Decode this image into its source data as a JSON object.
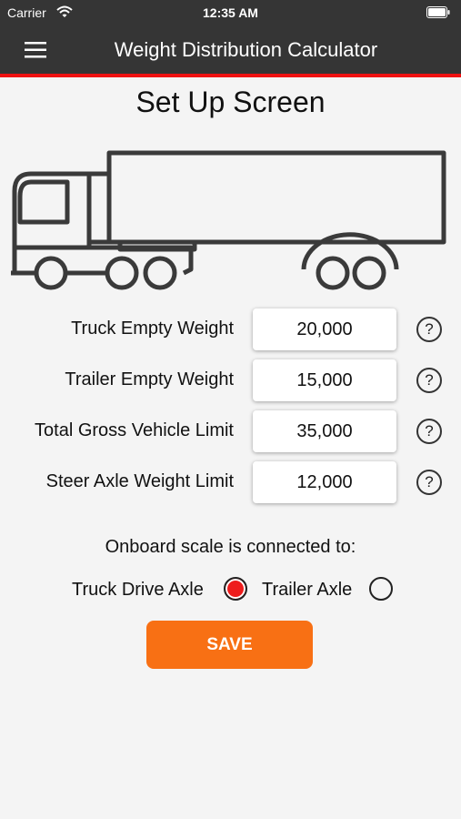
{
  "status_bar": {
    "carrier": "Carrier",
    "time": "12:35 AM"
  },
  "header": {
    "title": "Weight Distribution Calculator"
  },
  "page": {
    "title": "Set Up Screen"
  },
  "fields": [
    {
      "label": "Truck Empty Weight",
      "value": "20,000"
    },
    {
      "label": "Trailer Empty Weight",
      "value": "15,000"
    },
    {
      "label": "Total Gross Vehicle Limit",
      "value": "35,000"
    },
    {
      "label": "Steer Axle Weight Limit",
      "value": "12,000"
    }
  ],
  "help_symbol": "?",
  "scale": {
    "prompt": "Onboard scale is connected to:",
    "options": [
      {
        "label": "Truck Drive Axle",
        "selected": true
      },
      {
        "label": "Trailer Axle",
        "selected": false
      }
    ]
  },
  "save_label": "SAVE",
  "colors": {
    "accent": "#f87014",
    "nav_bg": "#353535",
    "red": "#ee1111"
  },
  "icons": [
    "menu-icon",
    "wifi-icon",
    "battery-icon",
    "truck-illustration",
    "help-icon"
  ]
}
